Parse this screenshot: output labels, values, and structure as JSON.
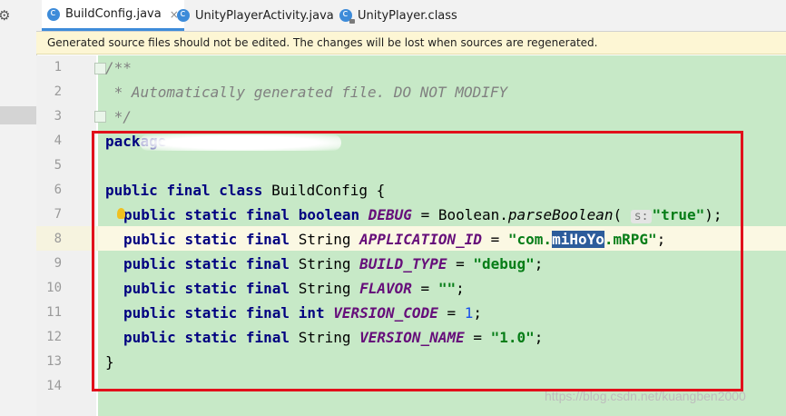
{
  "tabs": [
    {
      "label": "BuildConfig.java",
      "icon": "java-class-icon",
      "active": true,
      "closable": true
    },
    {
      "label": "UnityPlayerActivity.java",
      "icon": "java-class-icon",
      "active": false,
      "closable": true
    },
    {
      "label": "UnityPlayer.class",
      "icon": "compiled-class-icon",
      "active": false,
      "closable": false
    }
  ],
  "tab_close_glyph": "×",
  "banner": {
    "text": "Generated source files should not be edited. The changes will be lost when sources are regenerated."
  },
  "editor": {
    "line_numbers": [
      "1",
      "2",
      "3",
      "4",
      "5",
      "6",
      "7",
      "8",
      "9",
      "10",
      "11",
      "12",
      "13",
      "14"
    ],
    "current_line": "8",
    "code": {
      "l1": "/**",
      "l2": " * Automatically generated file. DO NOT MODIFY",
      "l3": " */",
      "kw_package": "package",
      "kw_public": "public",
      "kw_static": "static",
      "kw_final": "final",
      "kw_class": "class",
      "kw_boolean": "boolean",
      "kw_int": "int",
      "class_name": "BuildConfig",
      "open_brace": "{",
      "close_brace": "}",
      "type_string": "String",
      "boolean_type": "Boolean",
      "method": "parseBoolean",
      "param_hint": "s:",
      "f_debug": "DEBUG",
      "v_debug": "\"true\"",
      "f_app_id": "APPLICATION_ID",
      "v_app_id_pre": "\"com.",
      "v_app_id_sel": "miHoYo",
      "v_app_id_post": ".mRPG\"",
      "f_build_type": "BUILD_TYPE",
      "v_build_type": "\"debug\"",
      "f_flavor": "FLAVOR",
      "v_flavor": "\"\"",
      "f_version_code": "VERSION_CODE",
      "v_version_code": "1",
      "f_version_name": "VERSION_NAME",
      "v_version_name": "\"1.0\"",
      "eq": " = ",
      "semi": ";",
      "dot": ".",
      "lparen": "(",
      "rparen_semi": ");"
    }
  },
  "watermark": "https://blog.csdn.net/kuangben2000",
  "colors": {
    "highlight_box": "#e1101b",
    "generated_bg": "#c7e9c7",
    "banner_bg": "#fdf6d4",
    "tab_accent": "#3d8bd9"
  }
}
